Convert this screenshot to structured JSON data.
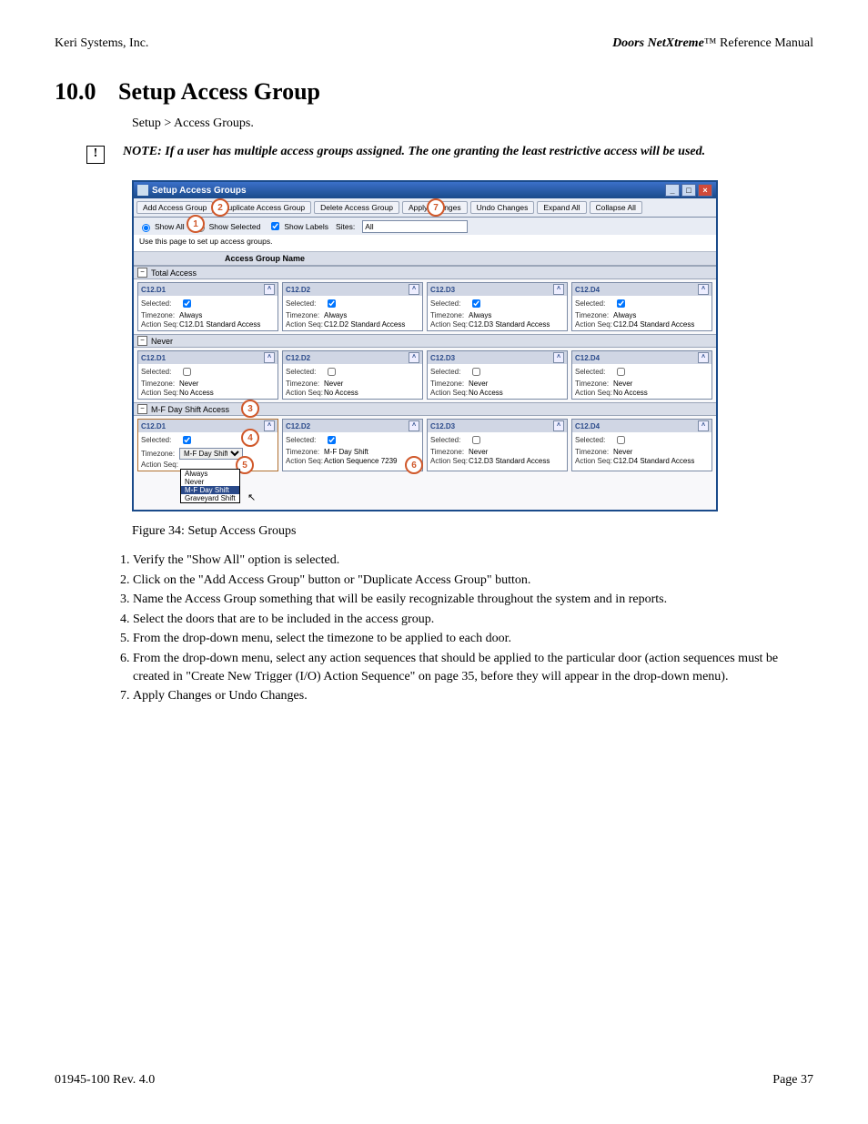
{
  "header": {
    "left": "Keri Systems, Inc.",
    "right_product": "Doors NetXtreme",
    "right_suffix": "™ Reference Manual"
  },
  "heading": {
    "number": "10.0",
    "title": "Setup Access Group"
  },
  "breadcrumb": "Setup > Access Groups.",
  "note": "NOTE: If a user has multiple access groups assigned. The one granting the least restrictive access will be used.",
  "window": {
    "title": "Setup Access Groups",
    "buttons": {
      "add": "Add Access Group",
      "duplicate": "Duplicate Access Group",
      "delete": "Delete Access Group",
      "apply": "Apply Changes",
      "undo": "Undo Changes",
      "expand": "Expand All",
      "collapse": "Collapse All"
    },
    "filter": {
      "show_all": "Show All",
      "show_selected": "Show Selected",
      "show_labels": "Show Labels",
      "sites_label": "Sites:",
      "sites_value": "All"
    },
    "hint": "Use this page to set up access groups.",
    "col_header": "Access Group Name",
    "labels": {
      "selected": "Selected:",
      "timezone": "Timezone:",
      "actionseq": "Action Seq:"
    },
    "groups": [
      {
        "name": "Total Access",
        "doors": [
          {
            "door": "C12.D1",
            "selected": true,
            "timezone": "Always",
            "actionseq": "C12.D1 Standard Access"
          },
          {
            "door": "C12.D2",
            "selected": true,
            "timezone": "Always",
            "actionseq": "C12.D2 Standard Access"
          },
          {
            "door": "C12.D3",
            "selected": true,
            "timezone": "Always",
            "actionseq": "C12.D3 Standard Access"
          },
          {
            "door": "C12.D4",
            "selected": true,
            "timezone": "Always",
            "actionseq": "C12.D4 Standard Access"
          }
        ]
      },
      {
        "name": "Never",
        "doors": [
          {
            "door": "C12.D1",
            "selected": false,
            "timezone": "Never",
            "actionseq": "No Access"
          },
          {
            "door": "C12.D2",
            "selected": false,
            "timezone": "Never",
            "actionseq": "No Access"
          },
          {
            "door": "C12.D3",
            "selected": false,
            "timezone": "Never",
            "actionseq": "No Access"
          },
          {
            "door": "C12.D4",
            "selected": false,
            "timezone": "Never",
            "actionseq": "No Access"
          }
        ]
      },
      {
        "name": "M-F Day Shift Access",
        "doors": [
          {
            "door": "C12.D1",
            "selected": true,
            "timezone": "M-F Day Shift",
            "actionseq": "",
            "tz_dropdown": true,
            "tz_options": [
              "Always",
              "Never",
              "M-F Day Shift",
              "Graveyard Shift"
            ],
            "tz_hilite": "M-F Day Shift",
            "highlighted_card": true
          },
          {
            "door": "C12.D2",
            "selected": true,
            "timezone": "M-F Day Shift",
            "actionseq": "Action Sequence 7239"
          },
          {
            "door": "C12.D3",
            "selected": false,
            "timezone": "Never",
            "actionseq": "C12.D3 Standard Access"
          },
          {
            "door": "C12.D4",
            "selected": false,
            "timezone": "Never",
            "actionseq": "C12.D4 Standard Access"
          }
        ]
      }
    ]
  },
  "figure_caption": "Figure 34: Setup Access Groups",
  "steps": [
    "Verify the \"Show All\" option is selected.",
    "Click on the \"Add Access Group\" button or \"Duplicate Access Group\" button.",
    "Name the Access Group something that will be easily recognizable throughout the system and in reports.",
    "Select the doors that are to be included in the access group.",
    "From the drop-down menu, select the timezone to be applied to each door.",
    "From the drop-down menu, select any action sequences that should be applied to the particular door (action sequences must be created in \"Create New Trigger (I/O) Action Sequence\" on page 35, before they will appear in the drop-down menu).",
    "Apply Changes or Undo Changes."
  ],
  "callouts": [
    "1",
    "2",
    "3",
    "4",
    "5",
    "6",
    "7"
  ],
  "footer": {
    "left": "01945-100  Rev. 4.0",
    "right": "Page 37"
  }
}
